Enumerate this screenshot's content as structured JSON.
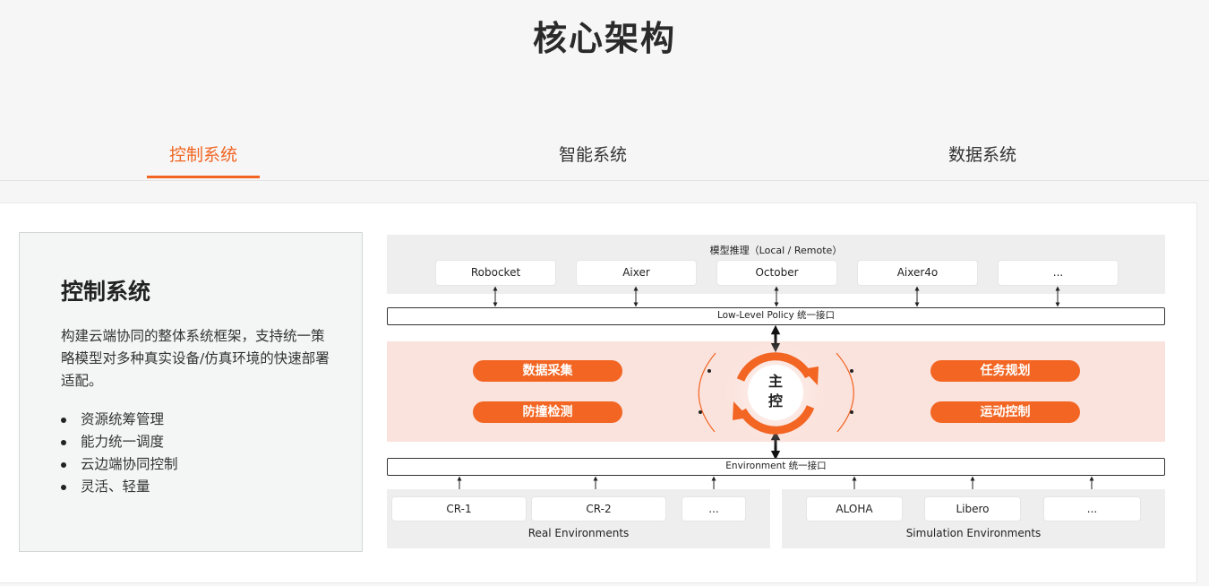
{
  "page": {
    "title": "核心架构"
  },
  "tabs": [
    {
      "label": "控制系统",
      "active": true
    },
    {
      "label": "智能系统",
      "active": false
    },
    {
      "label": "数据系统",
      "active": false
    }
  ],
  "card": {
    "title": "控制系统",
    "description": "构建云端协同的整体系统框架，支持统一策略模型对多种真实设备/仿真环境的快速部署适配。",
    "features": [
      "资源统筹管理",
      "能力统一调度",
      "云边端协同控制",
      "灵活、轻量"
    ]
  },
  "diagram": {
    "model_title": "模型推理（Local / Remote）",
    "models": [
      "Robocket",
      "Aixer",
      "October",
      "Aixer4o",
      "..."
    ],
    "policy_bar": "Low-Level Policy 统一接口",
    "core_left": [
      "数据采集",
      "防撞检测"
    ],
    "core_right": [
      "任务规划",
      "运动控制"
    ],
    "core_center": [
      "主",
      "控"
    ],
    "env_bar": "Environment 统一接口",
    "real_envs": [
      "CR-1",
      "CR-2",
      "..."
    ],
    "real_label": "Real Environments",
    "sim_envs": [
      "ALOHA",
      "Libero",
      "..."
    ],
    "sim_label": "Simulation Environments"
  },
  "colors": {
    "accent": "#f26522",
    "core_bg": "#fbe3dd"
  }
}
